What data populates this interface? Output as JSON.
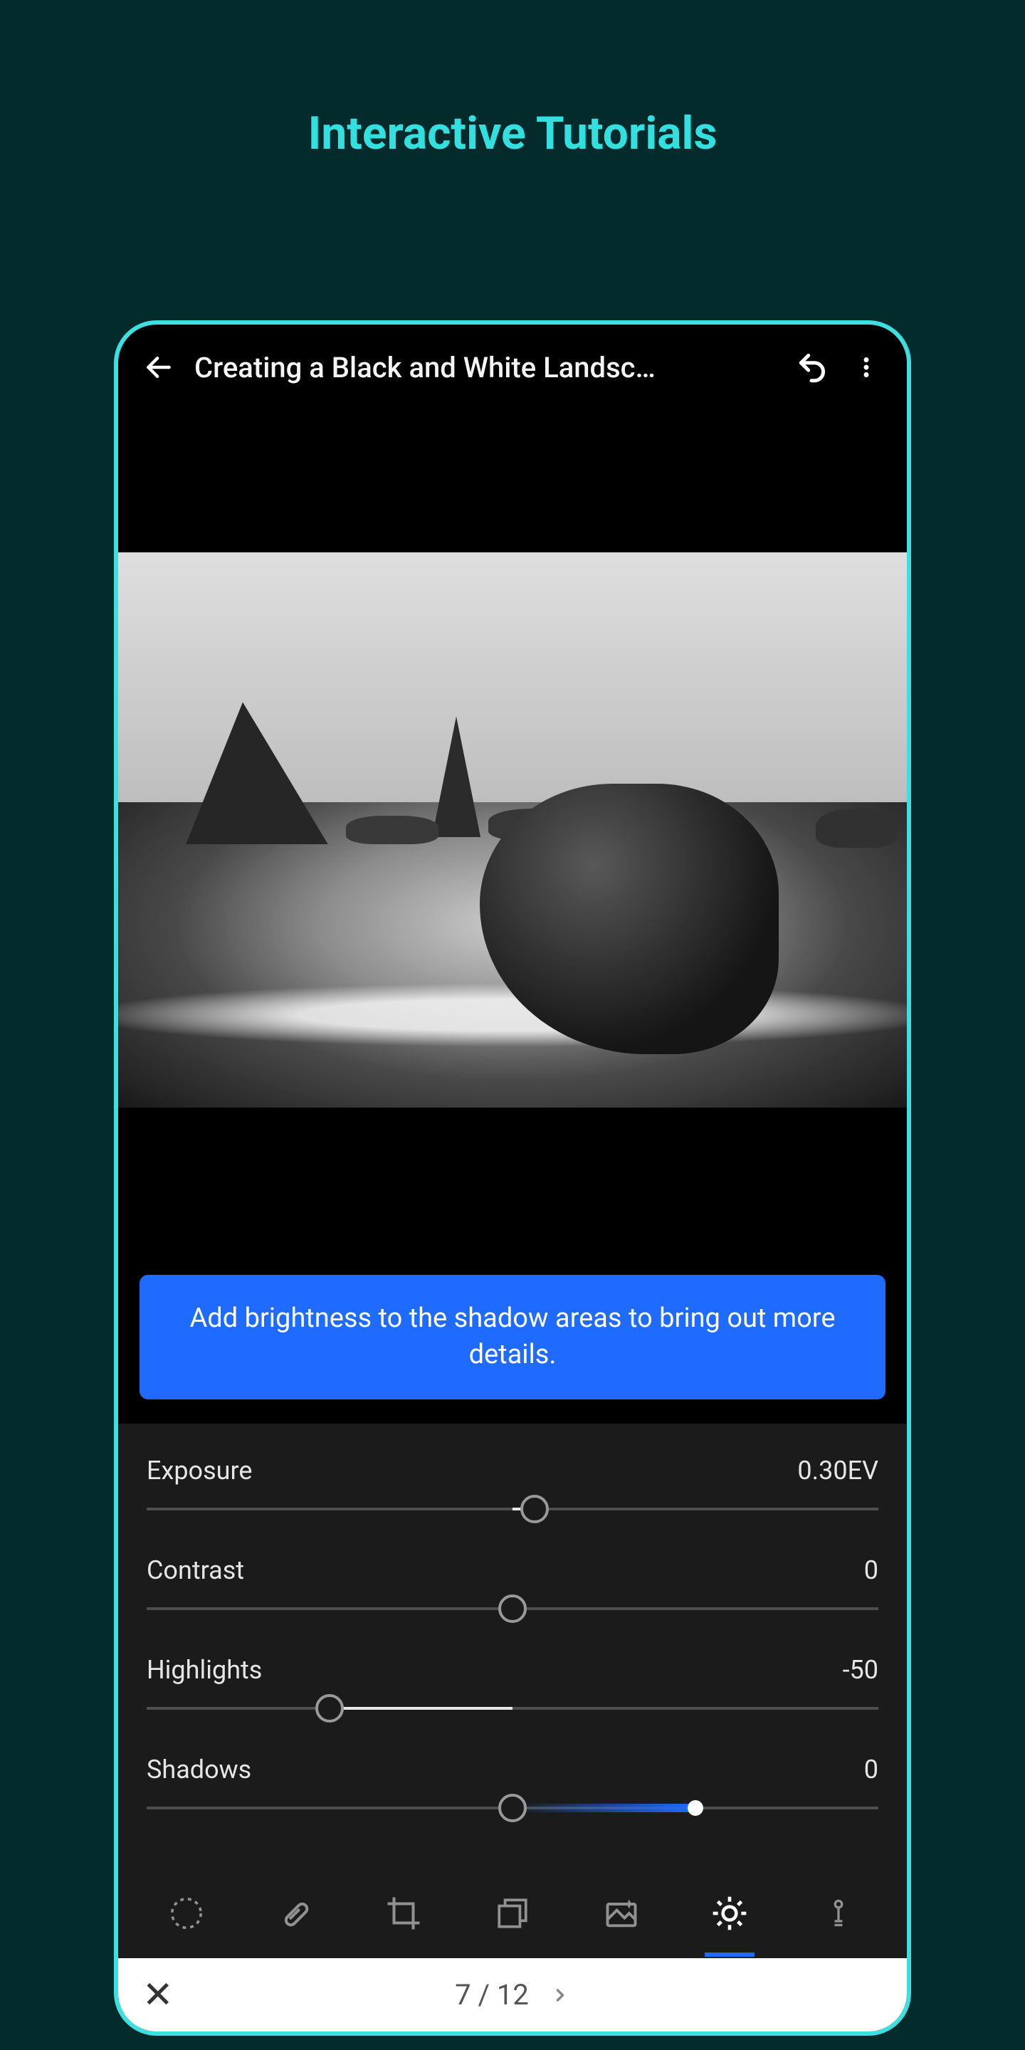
{
  "page_title": "Interactive Tutorials",
  "header": {
    "title": "Creating a Black and White Landsc…"
  },
  "tip": "Add brightness to the shadow areas to bring out more details.",
  "sliders": [
    {
      "label": "Exposure",
      "value_text": "0.30EV",
      "thumb_pct": 53,
      "fill_from_pct": 50,
      "fill_to_pct": 53,
      "hint": null
    },
    {
      "label": "Contrast",
      "value_text": "0",
      "thumb_pct": 50,
      "fill_from_pct": 50,
      "fill_to_pct": 50,
      "hint": null
    },
    {
      "label": "Highlights",
      "value_text": "-50",
      "thumb_pct": 25,
      "fill_from_pct": 25,
      "fill_to_pct": 50,
      "hint": null
    },
    {
      "label": "Shadows",
      "value_text": "0",
      "thumb_pct": 50,
      "fill_from_pct": 50,
      "fill_to_pct": 50,
      "hint": {
        "from_pct": 50,
        "to_pct": 75
      }
    }
  ],
  "toolbar": {
    "active_index": 5
  },
  "footer": {
    "step_text": "7 / 12"
  },
  "colors": {
    "accent": "#1f6bff",
    "teal": "#33e0e0"
  }
}
